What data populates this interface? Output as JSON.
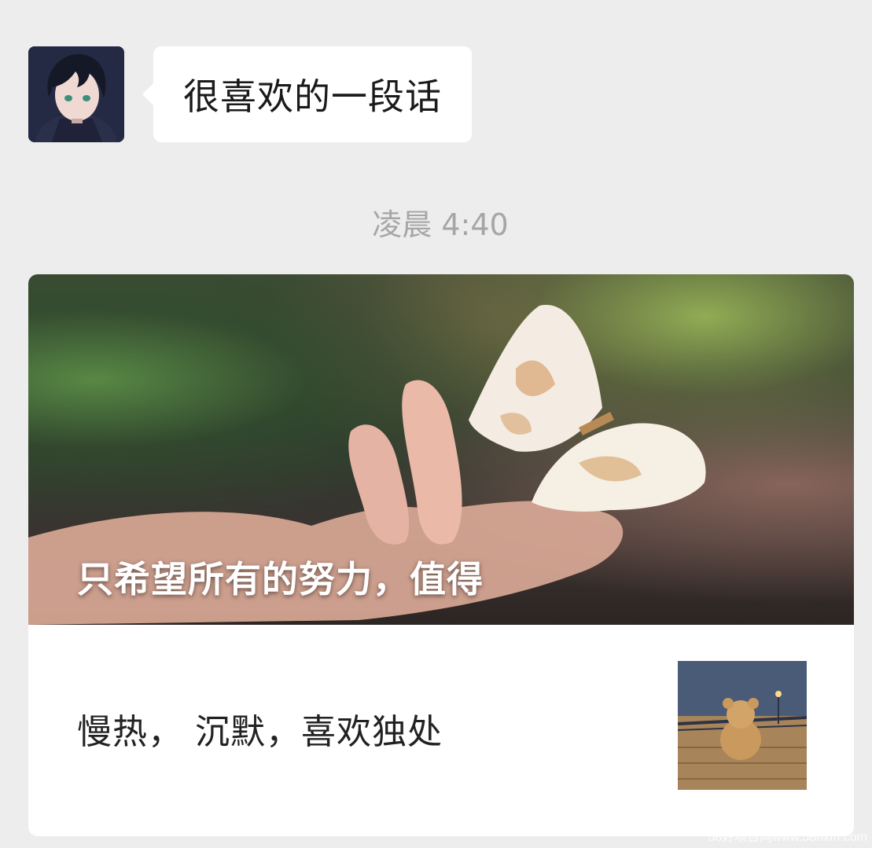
{
  "messages": {
    "incoming_text": "很喜欢的一段话",
    "avatar_icon": "anime-avatar-icon"
  },
  "timestamp": "凌晨 4:40",
  "article": {
    "cover_title": "只希望所有的努力，值得",
    "summary": "慢热， 沉默，喜欢独处",
    "cover_image": "hand-butterfly-image",
    "thumbnail": "teddy-bear-on-pier-image"
  },
  "watermark": "58好项目网www.58hxm.com"
}
